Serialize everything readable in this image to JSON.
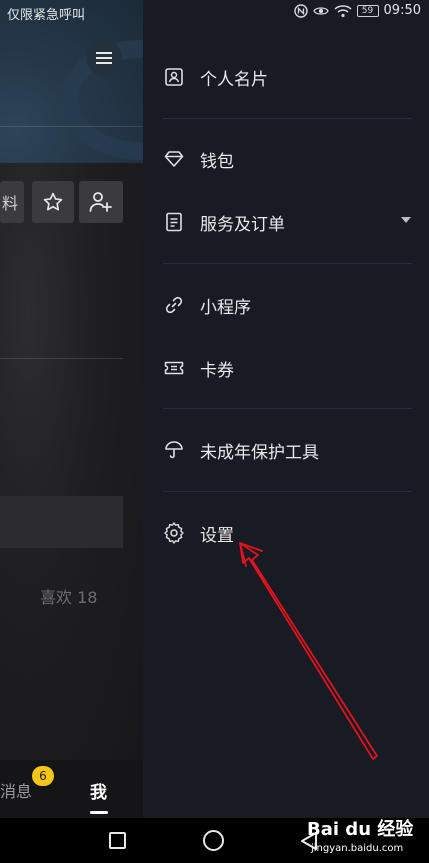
{
  "status_bar": {
    "left_text": "仅限紧急呼叫",
    "battery": "59",
    "time": "09:50",
    "icons": [
      "nfc-icon",
      "eye-icon",
      "wifi-icon",
      "battery-icon"
    ]
  },
  "background_profile": {
    "menu_icon": "hamburger-menu-icon",
    "partial_button_text": "料",
    "star_icon": "star-outline-icon",
    "add_user_icon": "add-user-icon",
    "likes_text": "喜欢 18",
    "tabs": {
      "messages_label": "消息",
      "messages_badge": "6",
      "me_label": "我"
    }
  },
  "drawer_menu": {
    "items": [
      {
        "label": "个人名片",
        "icon": "id-card-icon"
      },
      {
        "label": "钱包",
        "icon": "diamond-icon"
      },
      {
        "label": "服务及订单",
        "icon": "document-icon",
        "has_dropdown": true
      },
      {
        "label": "小程序",
        "icon": "link-icon"
      },
      {
        "label": "卡券",
        "icon": "ticket-icon"
      },
      {
        "label": "未成年保护工具",
        "icon": "umbrella-icon"
      },
      {
        "label": "设置",
        "icon": "settings-gear-icon"
      }
    ]
  },
  "nav_bar": {
    "buttons": [
      "recent-apps-square-icon",
      "home-circle-icon",
      "back-triangle-icon"
    ]
  },
  "watermark": {
    "logo": "Bai du 经验",
    "url": "jingyan.baidu.com"
  },
  "colors": {
    "drawer_bg": "#181a24",
    "annotation_arrow": "#e0141e",
    "badge": "#f5c518"
  }
}
